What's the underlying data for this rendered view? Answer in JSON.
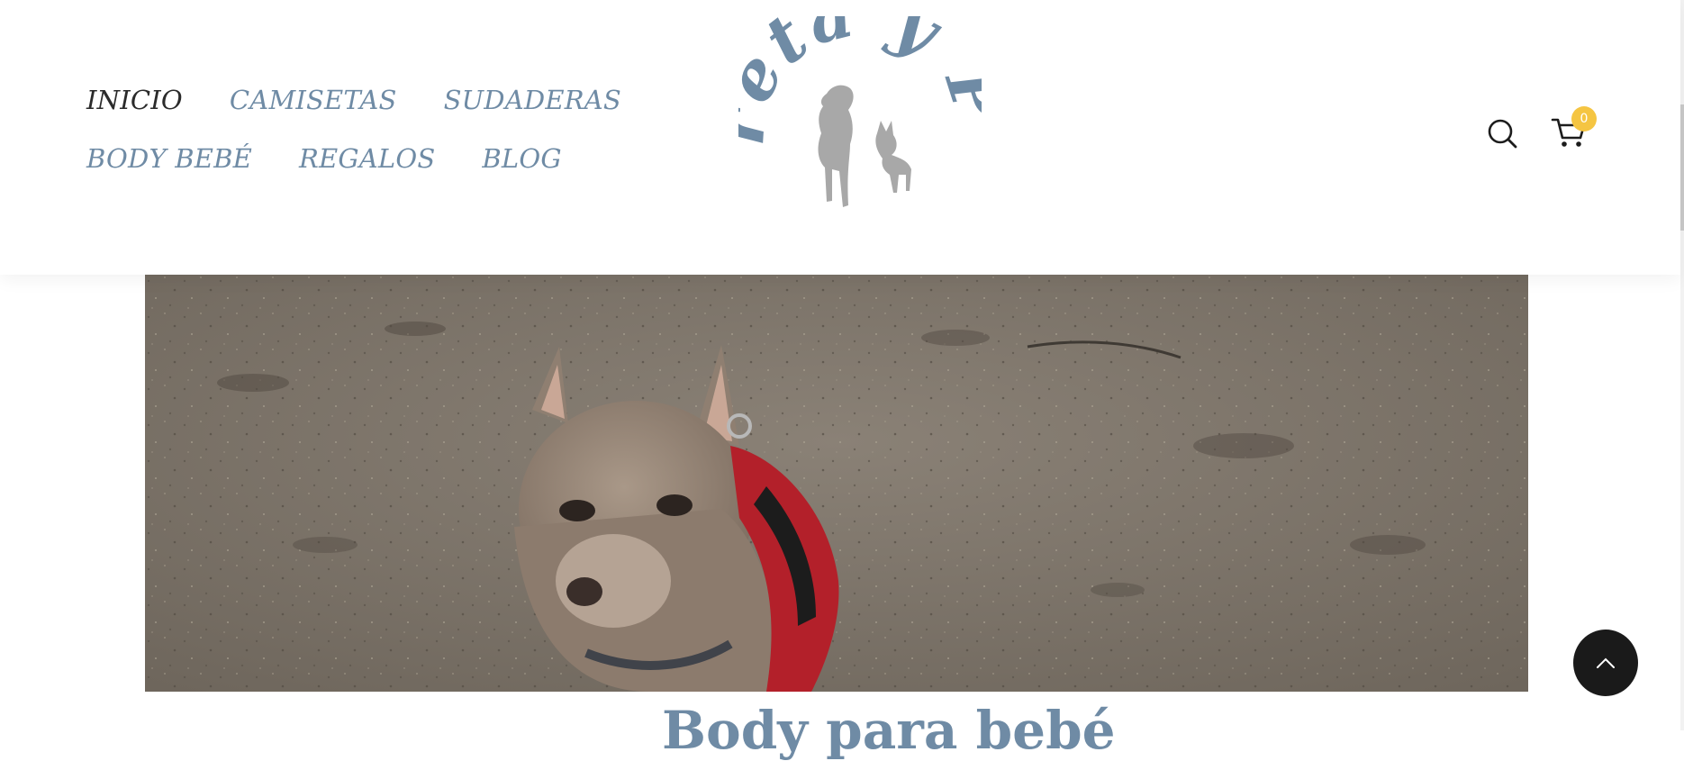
{
  "nav": {
    "row1": [
      {
        "label": "INICIO",
        "active": true
      },
      {
        "label": "CAMISETAS",
        "active": false
      },
      {
        "label": "SUDADERAS",
        "active": false
      }
    ],
    "row2": [
      {
        "label": "BODY BEBÉ",
        "active": false
      },
      {
        "label": "REGALOS",
        "active": false
      },
      {
        "label": "BLOG",
        "active": false
      }
    ]
  },
  "logo": {
    "text": "Greta y Pío",
    "color": "#6f8ba5",
    "dog_color": "#a8a8a8"
  },
  "header_icons": {
    "search_icon": "search-icon",
    "cart_icon": "cart-icon",
    "cart_count": "0",
    "badge_color": "#f5c542"
  },
  "hero": {
    "image": "chihuahua-in-red-harness-on-beach-sand"
  },
  "post": {
    "title": "Body para bebé"
  },
  "back_to_top": {
    "icon": "chevron-up-icon"
  },
  "colors": {
    "accent": "#6f8ba5",
    "active_nav": "#2b2b2b"
  }
}
